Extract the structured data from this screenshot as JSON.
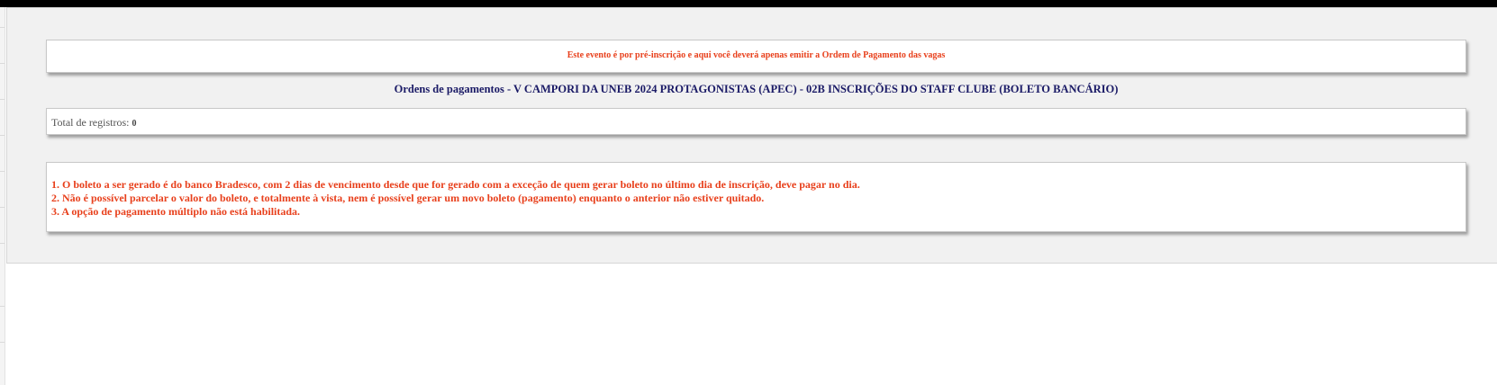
{
  "notice": {
    "text": "Este evento é por pré-inscrição e aqui você deverá apenas emitir a Ordem de Pagamento das vagas"
  },
  "page": {
    "title": "Ordens de pagamentos - V CAMPORI DA UNEB 2024 PROTAGONISTAS (APEC) - 02B INSCRIÇÕES DO STAFF CLUBE (BOLETO BANCÁRIO)"
  },
  "records": {
    "label": "Total de registros:",
    "count": "0"
  },
  "rules": [
    "1. O boleto a ser gerado é do banco Bradesco, com 2 dias de vencimento desde que for gerado com a exceção de quem gerar boleto no último dia de inscrição, deve pagar no dia.",
    "2. Não é possível parcelar o valor do boleto, e totalmente à vista, nem é possível gerar um novo boleto (pagamento) enquanto o anterior não estiver quitado.",
    "3. A opção de pagamento múltiplo não está habilitada."
  ],
  "colors": {
    "warning_red": "#e8401c",
    "title_navy": "#1a1a66",
    "panel_bg": "#f1f1f1"
  }
}
